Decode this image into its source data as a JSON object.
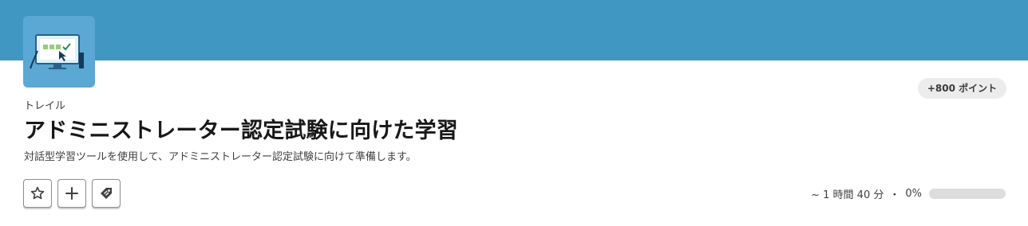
{
  "trail": {
    "points": "+800 ポイント",
    "type_label": "トレイル",
    "title": "アドミニストレーター認定試験に向けた学習",
    "description": "対話型学習ツールを使用して、アドミニストレーター認定試験に向けて準備します。"
  },
  "actions": [
    {
      "icon": "star-icon"
    },
    {
      "icon": "plus-icon"
    },
    {
      "icon": "tag-icon"
    }
  ],
  "progress": {
    "duration": "~ 1 時間 40 分",
    "separator": "・",
    "percent_label": "0%",
    "value": 0
  },
  "colors": {
    "banner": "#4097c2",
    "icon_background": "#5aa8d3",
    "badge_background": "#ececec",
    "progress_track": "#dddddd"
  }
}
